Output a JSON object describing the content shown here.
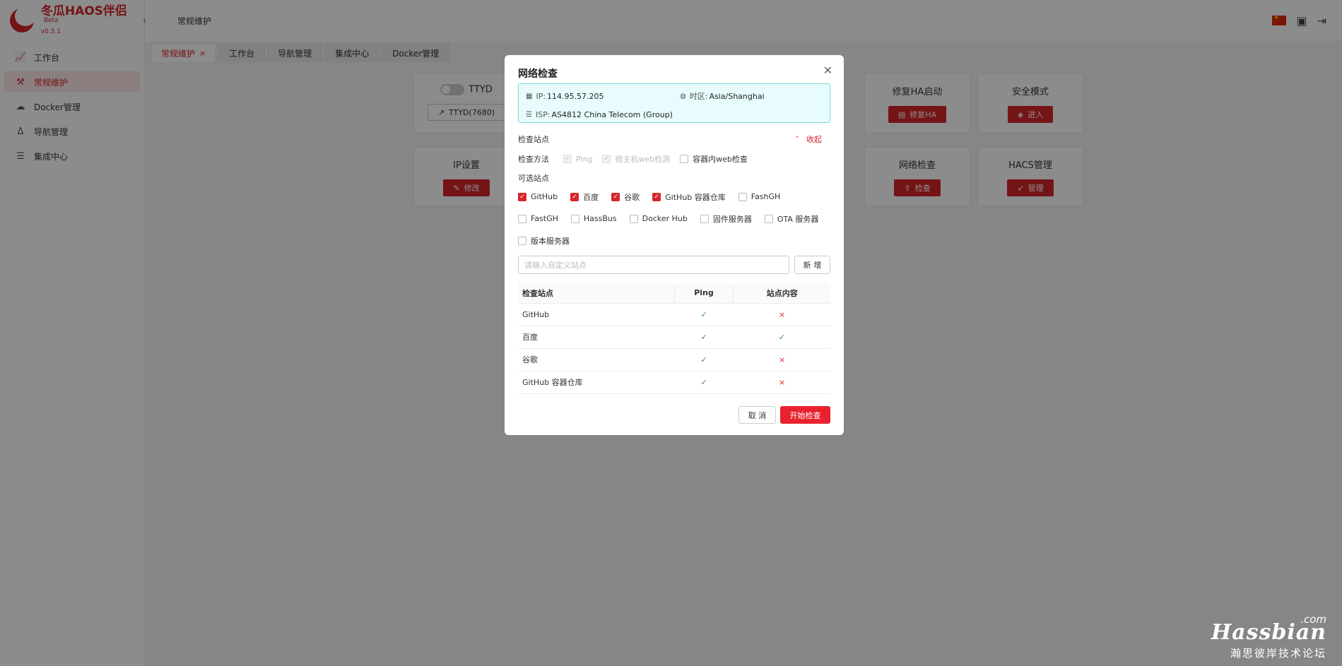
{
  "app": {
    "name": "冬瓜HAOS伴侣",
    "beta": "Beta",
    "version": "v0.5.1"
  },
  "sidebar": {
    "items": [
      {
        "label": "工作台",
        "icon": "chart-icon",
        "active": false
      },
      {
        "label": "常规维护",
        "icon": "maintenance-icon",
        "active": true
      },
      {
        "label": "Docker管理",
        "icon": "docker-icon",
        "active": false
      },
      {
        "label": "导航管理",
        "icon": "navigation-icon",
        "active": false
      },
      {
        "label": "集成中心",
        "icon": "integration-icon",
        "active": false
      }
    ]
  },
  "header": {
    "title": "常规维护",
    "icons": [
      "china-flag-icon",
      "chat-icon",
      "logout-icon"
    ]
  },
  "tabs": [
    {
      "label": "常规维护",
      "active": true,
      "closable": true
    },
    {
      "label": "工作台",
      "active": false
    },
    {
      "label": "导航管理",
      "active": false
    },
    {
      "label": "集成中心",
      "active": false
    },
    {
      "label": "Docker管理",
      "active": false
    }
  ],
  "cards": [
    {
      "title": "TTYD",
      "button": "TTYD(7680)"
    },
    {
      "title": "修复HA启动",
      "button": "修复HA"
    },
    {
      "title": "安全模式",
      "button": "进入"
    },
    {
      "title": "IP设置",
      "button": "修改"
    },
    {
      "title": "网络检查",
      "button": "检查"
    },
    {
      "title": "HACS管理",
      "button": "管理"
    }
  ],
  "modal": {
    "title": "网络检查",
    "info": {
      "ip_key": "IP:",
      "ip": "114.95.57.205",
      "tz_key": "时区:",
      "tz": "Asia/Shanghai",
      "isp_key": "ISP:",
      "isp": "AS4812 China Telecom (Group)"
    },
    "section_label": "检查站点",
    "collapse_label": "收起",
    "method_label": "检查方法",
    "methods": [
      {
        "label": "Ping",
        "checked": true,
        "disabled": true
      },
      {
        "label": "宿主机web检测",
        "checked": true,
        "disabled": true
      },
      {
        "label": "容器内web检查",
        "checked": false,
        "disabled": false
      }
    ],
    "optional_label": "可选站点",
    "sites": [
      {
        "label": "GitHub",
        "checked": true
      },
      {
        "label": "百度",
        "checked": true
      },
      {
        "label": "谷歌",
        "checked": true
      },
      {
        "label": "GitHub 容器仓库",
        "checked": true
      },
      {
        "label": "FashGH",
        "checked": false
      },
      {
        "label": "FastGH",
        "checked": false
      },
      {
        "label": "HassBus",
        "checked": false
      },
      {
        "label": "Docker Hub",
        "checked": false
      },
      {
        "label": "固件服务器",
        "checked": false
      },
      {
        "label": "OTA 服务器",
        "checked": false
      },
      {
        "label": "版本服务器",
        "checked": false
      }
    ],
    "custom_placeholder": "请输入自定义站点",
    "add_button": "新 增",
    "table": {
      "headers": [
        "检查站点",
        "Ping",
        "站点内容"
      ],
      "rows": [
        {
          "site": "GitHub",
          "ping": "✓",
          "content": "×"
        },
        {
          "site": "百度",
          "ping": "✓",
          "content": "✓"
        },
        {
          "site": "谷歌",
          "ping": "✓",
          "content": "×"
        },
        {
          "site": "GitHub 容器仓库",
          "ping": "✓",
          "content": "×"
        }
      ]
    },
    "cancel_button": "取 消",
    "start_button": "开始检查"
  },
  "watermark": {
    "com": ".com",
    "main": "Hassbian",
    "sub": "瀚思彼岸技术论坛"
  },
  "colors": {
    "accent": "#d6262b",
    "info_bg": "#e8fcfd",
    "info_border": "#7ed6d6"
  }
}
